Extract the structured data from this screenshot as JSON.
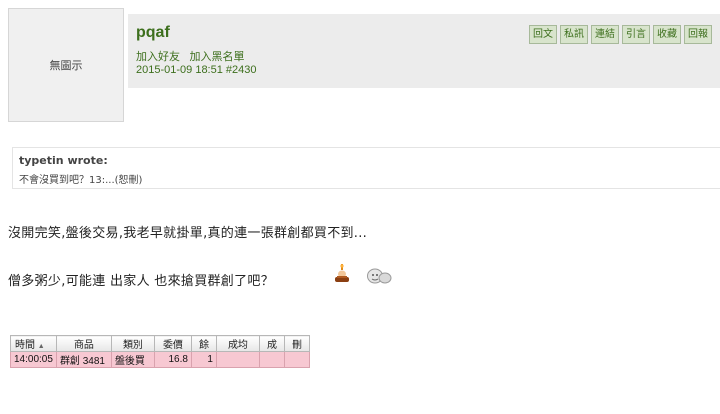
{
  "avatar": {
    "label": "無圖示"
  },
  "post": {
    "username": "pqaf",
    "add_friend": "加入好友",
    "add_blacklist": "加入黑名單",
    "datetime": "2015-01-09 18:51",
    "post_number": "#2430"
  },
  "actions": [
    "回文",
    "私訊",
    "連結",
    "引言",
    "收藏",
    "回報"
  ],
  "quote": {
    "author": "typetin wrote:",
    "text": "不會沒買到吧？13:...(恕刪)"
  },
  "body": {
    "line1": "沒開完笑,盤後交易,我老早就掛單,真的連一張群創都買不到...",
    "line2": "僧多粥少,可能連 出家人 也來搶買群創了吧？"
  },
  "icons": {
    "emoji1": "monk-incense-icon",
    "emoji2": "bald-face-icon"
  },
  "trade_table": {
    "headers": [
      "時間",
      "商品",
      "類別",
      "委價",
      "餘",
      "成均",
      "成",
      "刪"
    ],
    "rows": [
      [
        "14:00:05",
        "群創 3481",
        "盤後買",
        "16.8",
        "1",
        "",
        "",
        ""
      ]
    ]
  }
}
